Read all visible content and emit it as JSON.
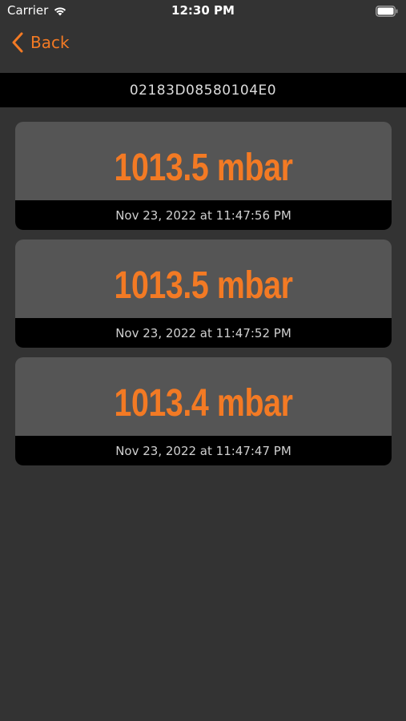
{
  "status_bar": {
    "carrier": "Carrier",
    "time": "12:30 PM",
    "wifi_icon": "wifi-icon",
    "battery_icon": "battery-icon"
  },
  "nav": {
    "back_label": "Back",
    "back_icon": "chevron-left-icon",
    "accent_color": "#f37a24"
  },
  "device": {
    "id": "02183D08580104E0"
  },
  "readings": [
    {
      "value": "1013.5 mbar",
      "timestamp": "Nov 23, 2022 at 11:47:56 PM"
    },
    {
      "value": "1013.5 mbar",
      "timestamp": "Nov 23, 2022 at 11:47:52 PM"
    },
    {
      "value": "1013.4 mbar",
      "timestamp": "Nov 23, 2022 at 11:47:47 PM"
    }
  ],
  "colors": {
    "background": "#333333",
    "card": "#555555",
    "bar": "#000000",
    "accent": "#f37a24"
  }
}
